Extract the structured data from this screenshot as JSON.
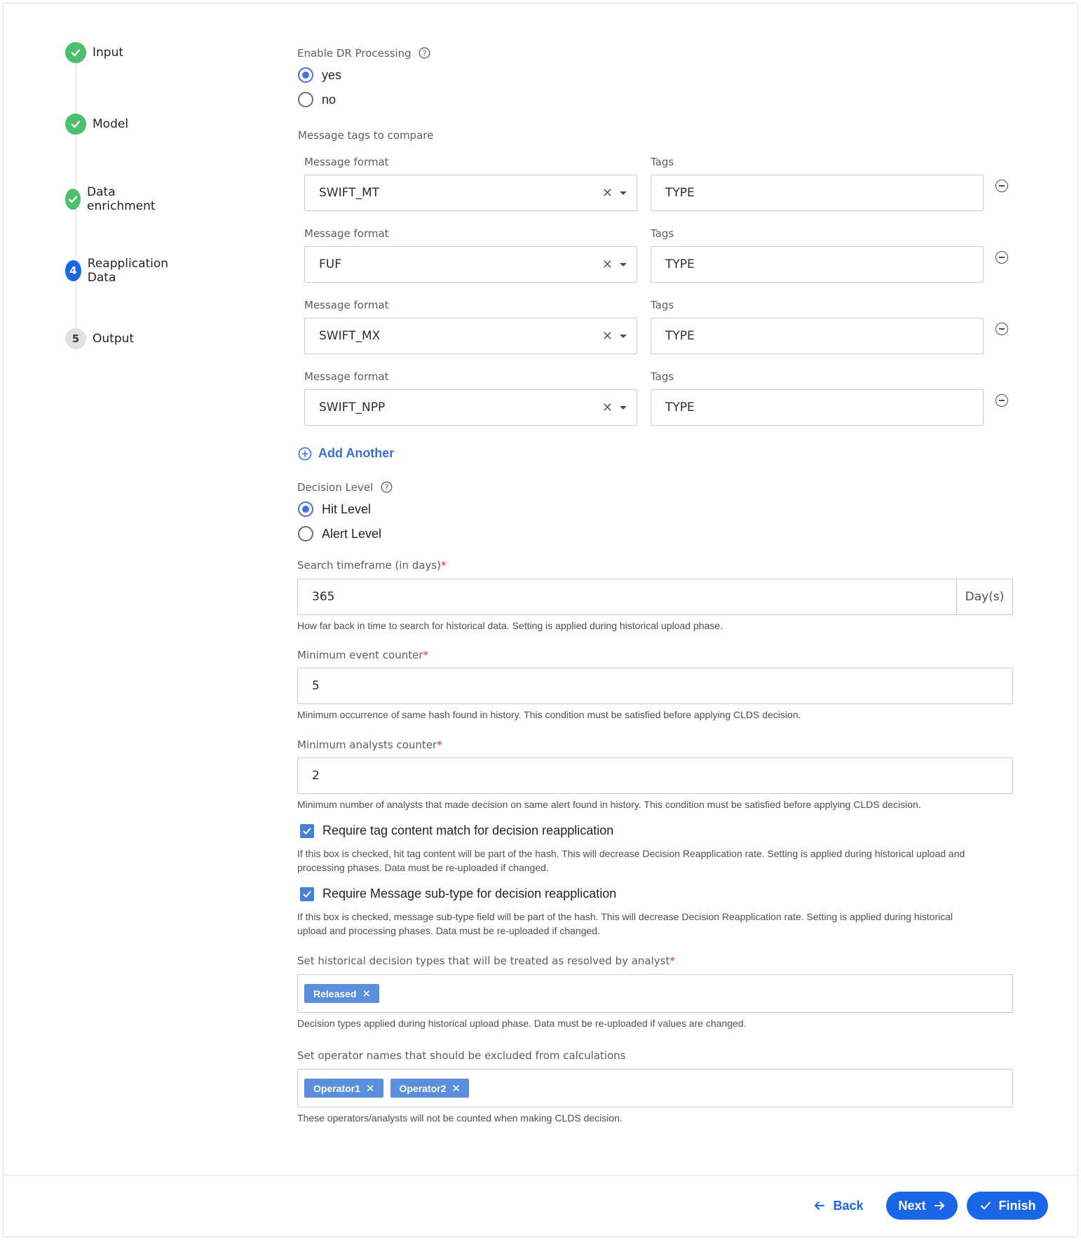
{
  "stepper": {
    "steps": [
      {
        "label": "Input",
        "state": "done"
      },
      {
        "label": "Model",
        "state": "done"
      },
      {
        "label": "Data enrichment",
        "state": "done"
      },
      {
        "label": "Reapplication Data",
        "state": "active",
        "number": "4"
      },
      {
        "label": "Output",
        "state": "todo",
        "number": "5"
      }
    ]
  },
  "dr_processing": {
    "label": "Enable DR Processing",
    "options": [
      "yes",
      "no"
    ],
    "selected": "yes"
  },
  "message_tags": {
    "section_label": "Message tags to compare",
    "format_label": "Message format",
    "tags_label": "Tags",
    "rows": [
      {
        "format": "SWIFT_MT",
        "tags": "TYPE"
      },
      {
        "format": "FUF",
        "tags": "TYPE"
      },
      {
        "format": "SWIFT_MX",
        "tags": "TYPE"
      },
      {
        "format": "SWIFT_NPP",
        "tags": "TYPE"
      }
    ],
    "add_another": "Add Another"
  },
  "decision_level": {
    "label": "Decision Level",
    "options": [
      "Hit Level",
      "Alert Level"
    ],
    "selected": "Hit Level"
  },
  "search_timeframe": {
    "label": "Search timeframe (in days)",
    "value": "365",
    "suffix": "Day(s)",
    "hint": "How far back in time to search for historical data. Setting is applied during historical upload phase."
  },
  "min_event_counter": {
    "label": "Minimum event counter",
    "value": "5",
    "hint": "Minimum occurrence of same hash found in history. This condition must be satisfied before applying CLDS decision."
  },
  "min_analysts_counter": {
    "label": "Minimum analysts counter",
    "value": "2",
    "hint": "Minimum number of analysts that made decision on same alert found in history. This condition must be satisfied before applying CLDS decision."
  },
  "tag_content_match": {
    "label": "Require tag content match for decision reapplication",
    "checked": true,
    "hint_line1": "If this box is checked, hit tag content will be part of the hash. This will decrease Decision Reapplication rate. Setting is applied during historical upload and",
    "hint_line2": "processing phases. Data must be re-uploaded if changed."
  },
  "message_subtype": {
    "label": "Require Message sub-type for decision reapplication",
    "checked": true,
    "hint_line1": "If this box is checked, message sub-type field will be part of the hash. This will decrease Decision Reapplication rate. Setting is applied during historical",
    "hint_line2": "upload and processing phases. Data must be re-uploaded if changed."
  },
  "resolved_types": {
    "label": "Set historical decision types that will be treated as resolved by analyst",
    "chips": [
      "Released"
    ],
    "hint": "Decision types applied during historical upload phase. Data must be re-uploaded if values are changed."
  },
  "excluded_operators": {
    "label": "Set operator names that should be excluded from calculations",
    "chips": [
      "Operator1",
      "Operator2"
    ],
    "hint": "These operators/analysts will not be counted when making CLDS decision."
  },
  "footer": {
    "back": "Back",
    "next": "Next",
    "finish": "Finish"
  },
  "colors": {
    "primary": "#1a66e6",
    "success": "#4cbe6c",
    "chip": "#5b8fdc"
  }
}
